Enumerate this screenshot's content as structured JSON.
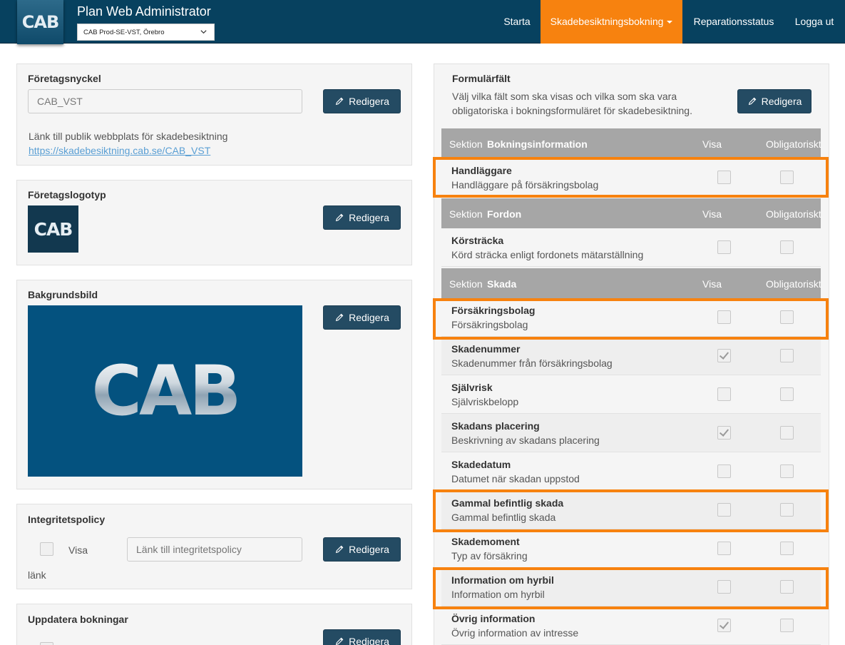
{
  "header": {
    "logo_text": "CAB",
    "app_title": "Plan Web Administrator",
    "org_select": "CAB Prod-SE-VST, Örebro",
    "nav": [
      {
        "label": "Starta"
      },
      {
        "label": "Skadebesiktningsbokning",
        "active": true
      },
      {
        "label": "Reparationsstatus"
      },
      {
        "label": "Logga ut"
      }
    ]
  },
  "colors": {
    "navbar": "#07415f",
    "accent": "#f7820f",
    "button": "#244b63",
    "section_header": "#a6a6a6"
  },
  "left": {
    "company_key": {
      "title": "Företagsnyckel",
      "value": "CAB_VST",
      "button": "Redigera",
      "link_label": "Länk till publik webbplats för skadebesiktning",
      "link": "https://skadebesiktning.cab.se/CAB_VST"
    },
    "company_logo": {
      "title": "Företagslogotyp",
      "logo_text": "CAB",
      "button": "Redigera"
    },
    "background": {
      "title": "Bakgrundsbild",
      "logo_text": "CAB",
      "button": "Redigera"
    },
    "privacy": {
      "title": "Integritetspolicy",
      "checkbox_label": "Visa",
      "checkbox_label2": "länk",
      "placeholder": "Länk till integritetspolicy",
      "button": "Redigera"
    },
    "update": {
      "title": "Uppdatera bokningar",
      "button": "Redigera"
    }
  },
  "right": {
    "title": "Formulärfält",
    "description_line1": "Välj vilka fält som ska visas och vilka som ska vara",
    "description_line2": "obligatoriska i bokningsformuläret för skadebesiktning.",
    "button": "Redigera",
    "sections": [
      {
        "prefix": "Sektion",
        "name": "Bokningsinformation",
        "visa": "Visa",
        "oblig": "Obligatoriskt",
        "rows": [
          {
            "name": "Handläggare",
            "desc": "Handläggare på försäkringsbolag",
            "visa": false,
            "oblig": false,
            "highlight": true
          }
        ]
      },
      {
        "prefix": "Sektion",
        "name": "Fordon",
        "visa": "Visa",
        "oblig": "Obligatoriskt",
        "rows": [
          {
            "name": "Körsträcka",
            "desc": "Körd sträcka enligt fordonets mätarställning",
            "visa": false,
            "oblig": false,
            "highlight": false
          }
        ]
      },
      {
        "prefix": "Sektion",
        "name": "Skada",
        "visa": "Visa",
        "oblig": "Obligatoriskt",
        "rows": [
          {
            "name": "Försäkringsbolag",
            "desc": "Försäkringsbolag",
            "visa": false,
            "oblig": false,
            "highlight": true
          },
          {
            "name": "Skadenummer",
            "desc": "Skadenummer från försäkringsbolag",
            "visa": true,
            "oblig": false,
            "highlight": false
          },
          {
            "name": "Självrisk",
            "desc": "Självriskbelopp",
            "visa": false,
            "oblig": false,
            "highlight": false
          },
          {
            "name": "Skadans placering",
            "desc": "Beskrivning av skadans placering",
            "visa": true,
            "oblig": false,
            "highlight": false
          },
          {
            "name": "Skadedatum",
            "desc": "Datumet när skadan uppstod",
            "visa": false,
            "oblig": false,
            "highlight": false
          },
          {
            "name": "Gammal befintlig skada",
            "desc": "Gammal befintlig skada",
            "visa": false,
            "oblig": false,
            "highlight": true
          },
          {
            "name": "Skademoment",
            "desc": "Typ av försäkring",
            "visa": false,
            "oblig": false,
            "highlight": false
          },
          {
            "name": "Information om hyrbil",
            "desc": "Information om hyrbil",
            "visa": false,
            "oblig": false,
            "highlight": true
          },
          {
            "name": "Övrig information",
            "desc": "Övrig information av intresse",
            "visa": true,
            "oblig": false,
            "highlight": false
          }
        ]
      }
    ]
  }
}
